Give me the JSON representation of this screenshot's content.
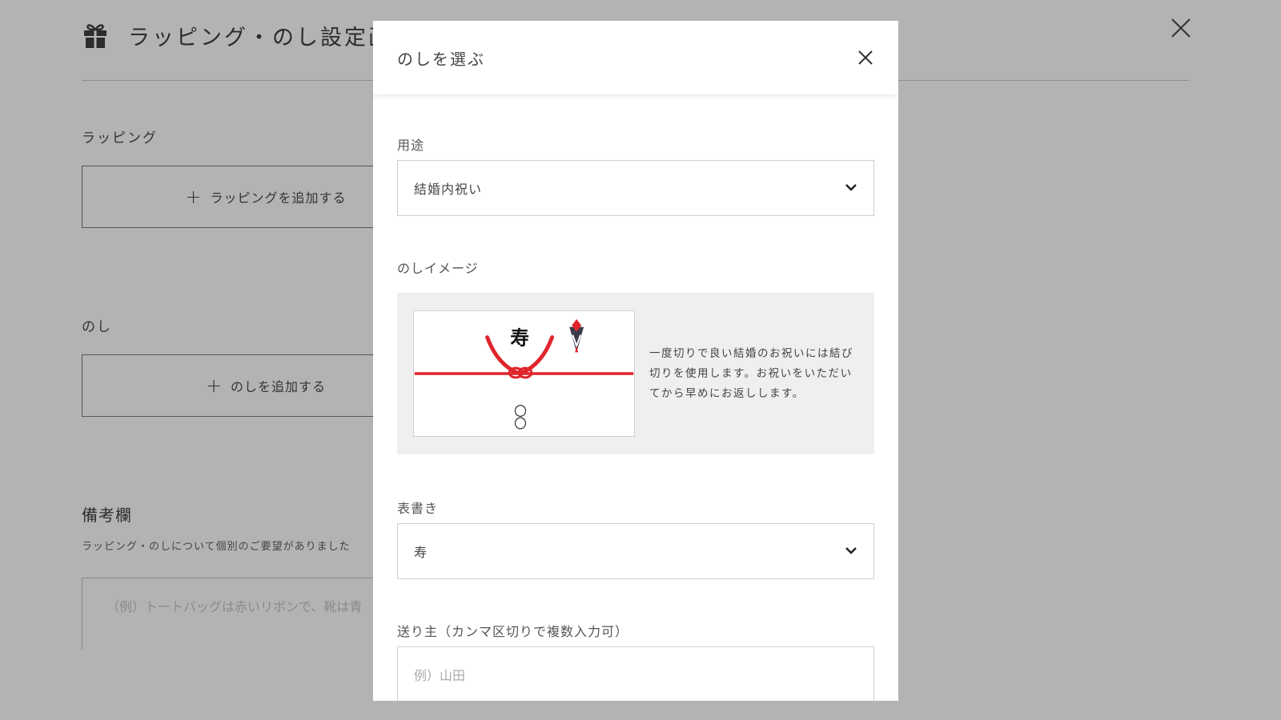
{
  "background": {
    "title": "ラッピング・のし設定画面",
    "wrapping_label": "ラッピング",
    "wrapping_add_button": "ラッピングを追加する",
    "noshi_label": "のし",
    "noshi_add_button": "のしを追加する",
    "notes_title": "備考欄",
    "notes_description": "ラッピング・のしについて個別のご要望がありました",
    "notes_placeholder": "（例）トートバッグは赤いリボンで、靴は青"
  },
  "modal": {
    "title": "のしを選ぶ",
    "purpose": {
      "label": "用途",
      "selected": "結婚内祝い"
    },
    "image": {
      "label": "のしイメージ",
      "omote": "寿",
      "name_placeholder_marks": "〇〇",
      "description": "一度切りで良い結婚のお祝いには結び切りを使用します。お祝いをいただいてから早めにお返しします。"
    },
    "omotegaki": {
      "label": "表書き",
      "selected": "寿"
    },
    "sender": {
      "label": "送り主（カンマ区切りで複数入力可）",
      "placeholder": "例）山田"
    }
  },
  "colors": {
    "mizuhiki_red": "#e0242b",
    "overlay_bg": "#b3b3b3",
    "panel_bg": "#efefef"
  }
}
